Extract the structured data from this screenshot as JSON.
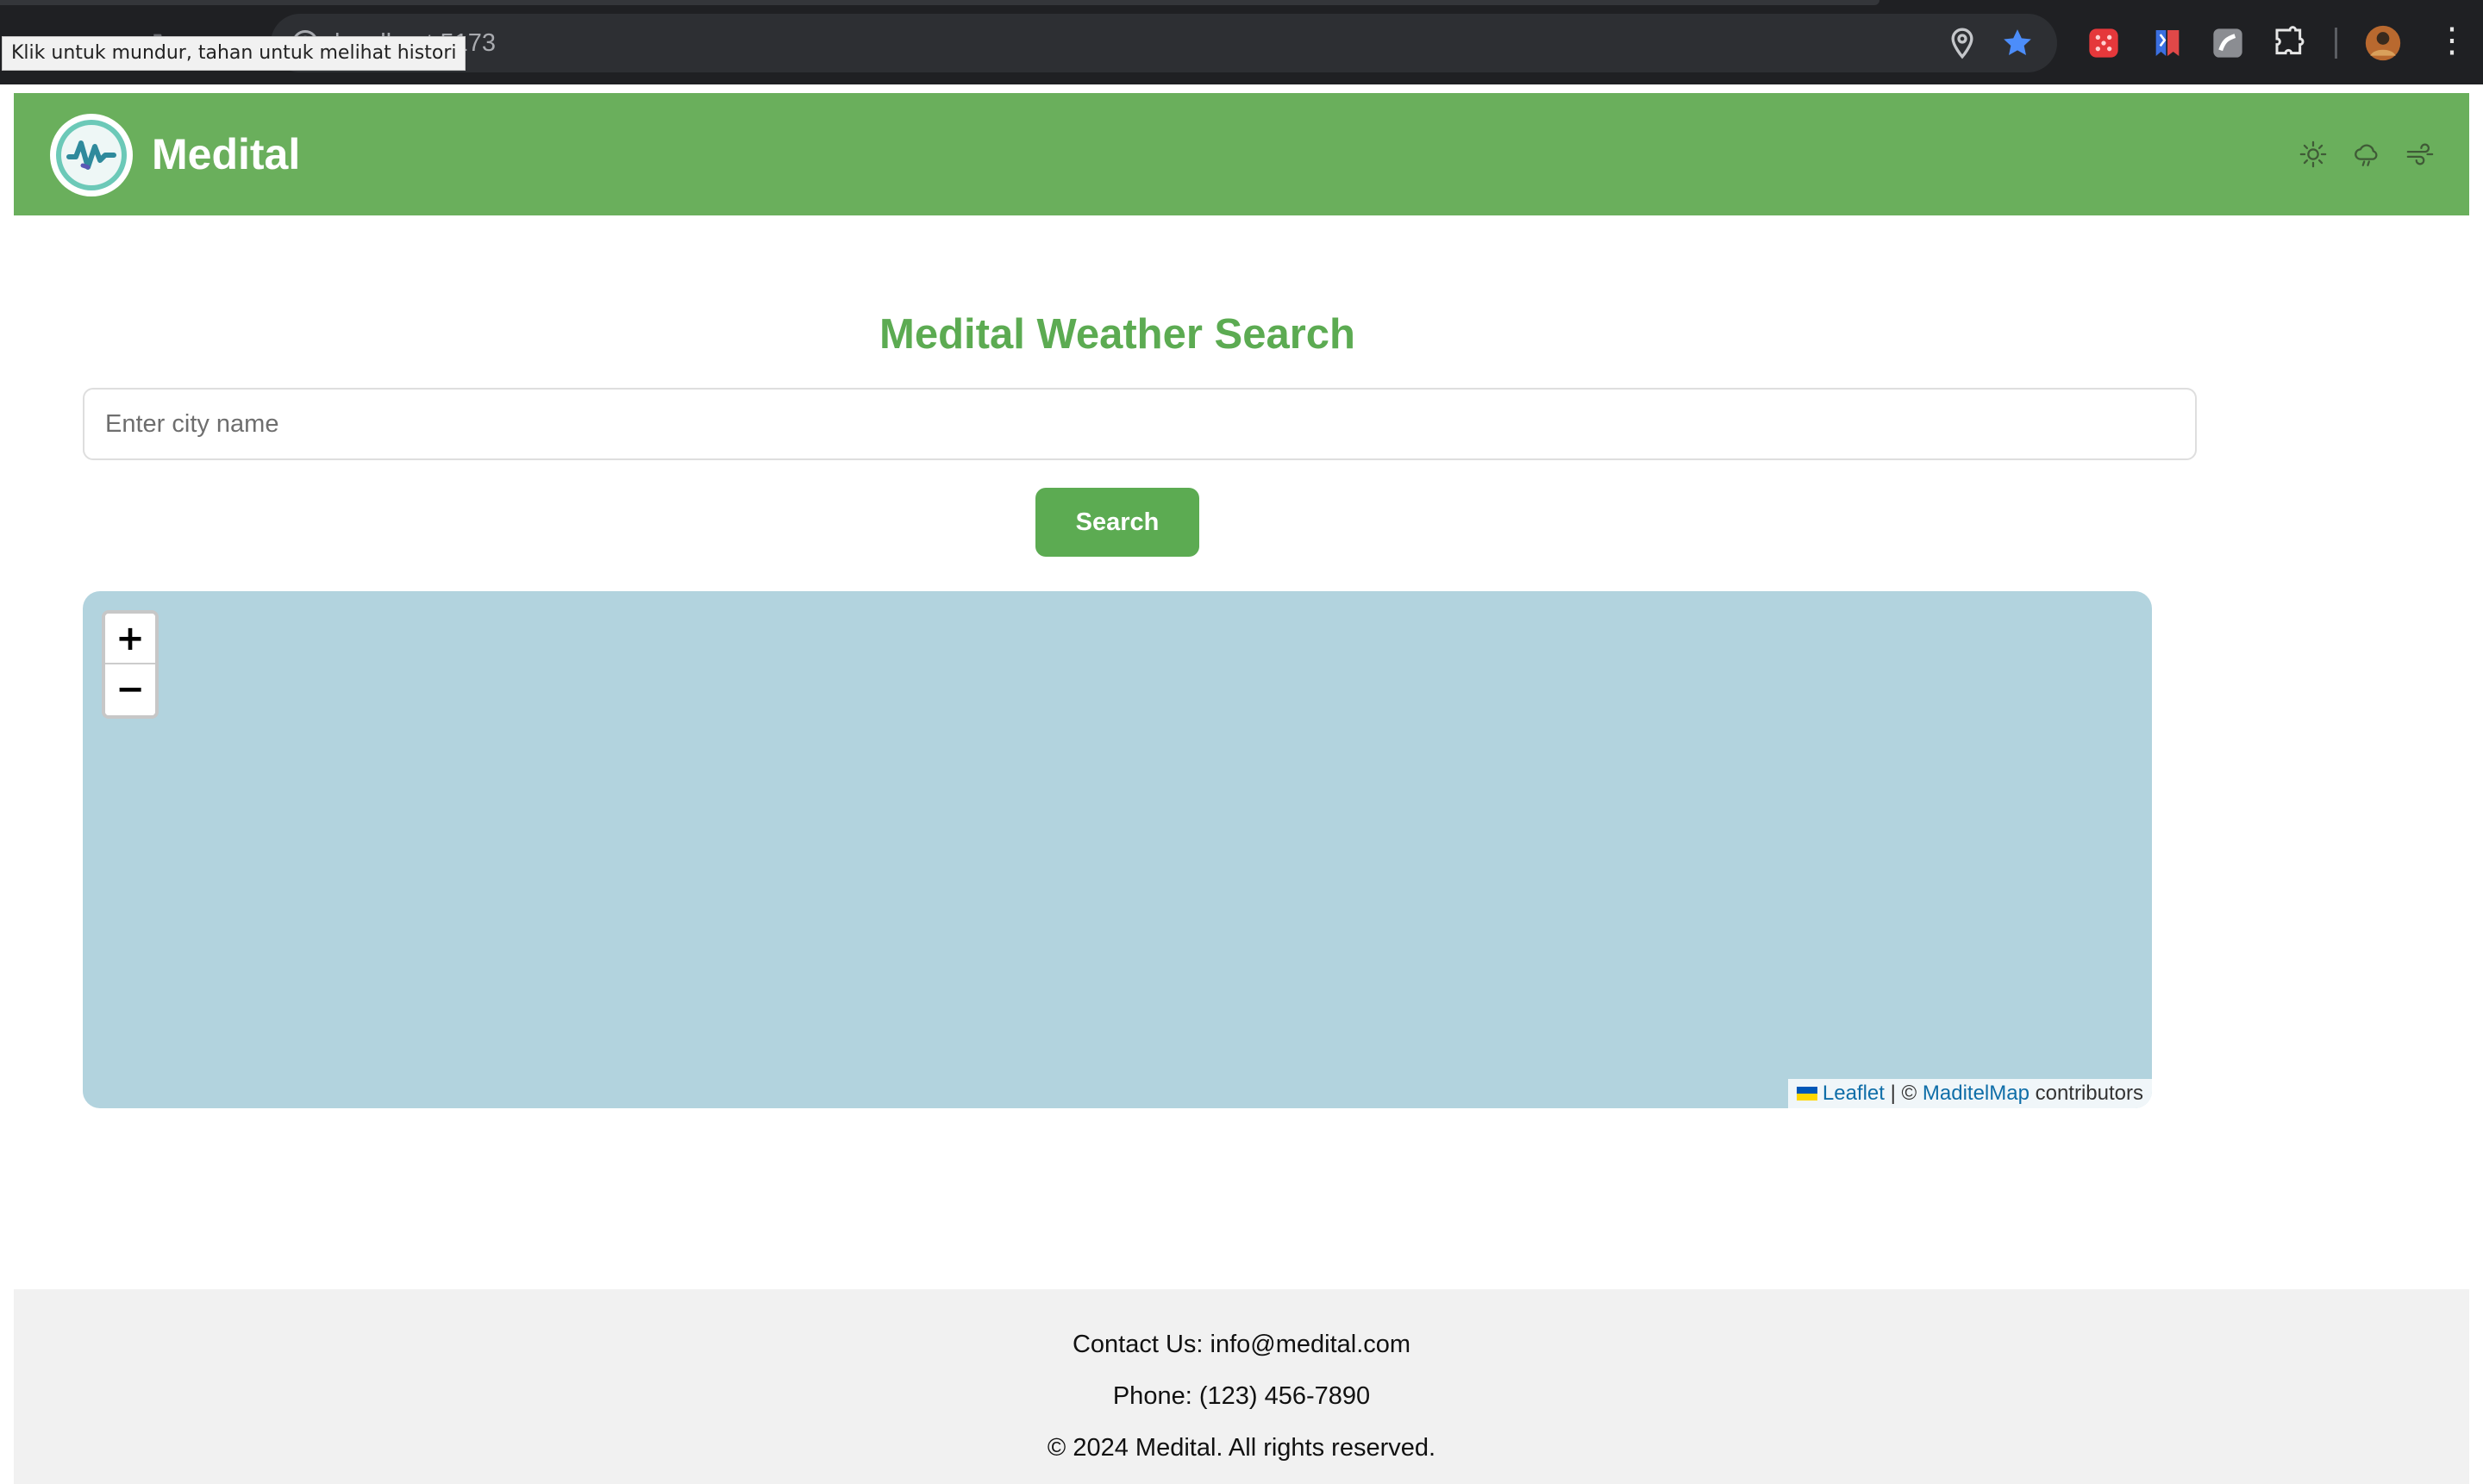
{
  "browser": {
    "url": "localhost:5173",
    "tooltip": "Klik untuk mundur, tahan untuk melihat histori",
    "omnibox_icons": [
      "location-pin-icon",
      "bookmark-star-icon"
    ],
    "extensions": [
      "red-extension-icon",
      "bookmark-flag-extension-icon",
      "gray-extension-icon",
      "puzzle-extensions-icon"
    ],
    "star_color": "#4c8dfa"
  },
  "header": {
    "brand": "Medital",
    "background_color": "#6aaf5c",
    "icons": [
      "sun-icon",
      "cloud-rain-icon",
      "wind-icon"
    ]
  },
  "main": {
    "title": "Medital Weather Search",
    "title_color": "#5cab52",
    "search": {
      "placeholder": "Enter city name",
      "value": "",
      "button_label": "Search"
    }
  },
  "map": {
    "zoom_in_label": "+",
    "zoom_out_label": "−",
    "attribution": {
      "leaflet": "Leaflet",
      "separator": "| ©",
      "provider": "MaditelMap",
      "suffix": "contributors"
    },
    "background_color": "#b2d3de"
  },
  "footer": {
    "contact": "Contact Us: info@medital.com",
    "phone": "Phone: (123) 456-7890",
    "copyright": "© 2024 Medital. All rights reserved."
  }
}
